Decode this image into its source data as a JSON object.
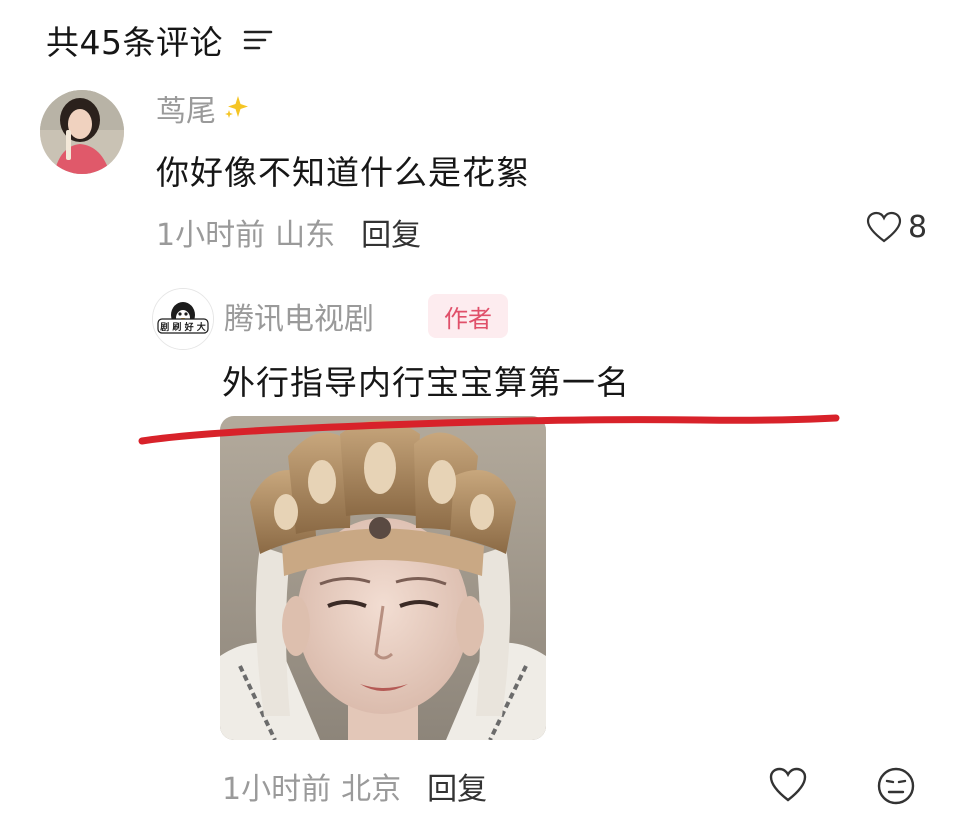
{
  "header": {
    "title": "共45条评论",
    "filter_icon": "filter-lines-icon"
  },
  "comments": [
    {
      "username": "茑尾",
      "badge_icon": "sparkle-icon",
      "text": "你好像不知道什么是花絮",
      "time": "1小时前",
      "location": "山东",
      "reply_label": "回复",
      "likes": "8",
      "replies": [
        {
          "username": "腾讯电视剧",
          "badge": "作者",
          "text": "外行指导内行宝宝算第一名",
          "image": "buddha-statue-photo",
          "time": "1小时前",
          "location": "北京",
          "reply_label": "回复"
        }
      ]
    }
  ],
  "colors": {
    "text_primary": "#161616",
    "text_secondary": "#9a9a9a",
    "author_badge_bg": "#fdecef",
    "author_badge_fg": "#e0506a",
    "annotation_red": "#d8222a"
  }
}
